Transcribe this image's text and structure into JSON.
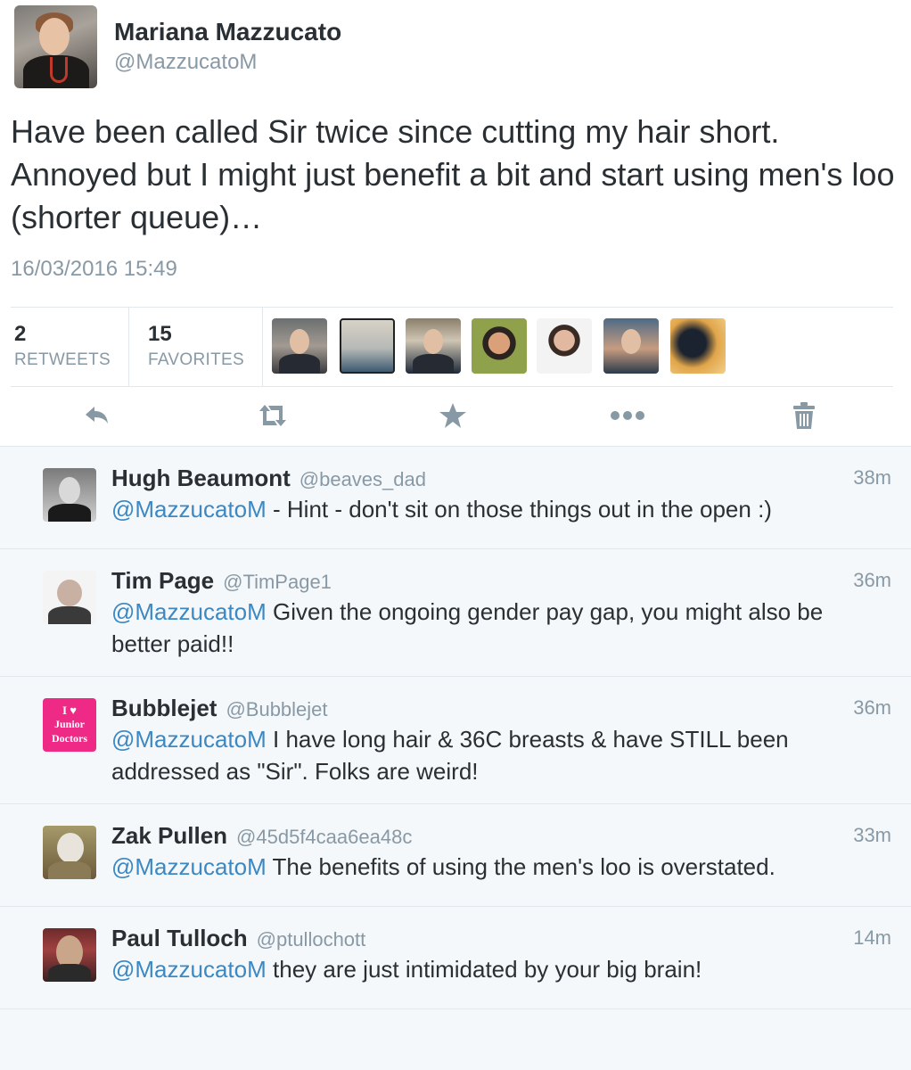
{
  "tweet": {
    "author_name": "Mariana Mazzucato",
    "author_handle": "@MazzucatoM",
    "text": "Have been called Sir twice since cutting my hair short. Annoyed but I might just benefit a bit and start using men's loo (shorter queue)…",
    "timestamp": "16/03/2016 15:49",
    "retweets_count": "2",
    "retweets_label": "RETWEETS",
    "favorites_count": "15",
    "favorites_label": "FAVORITES"
  },
  "actions": [
    "reply-icon",
    "retweet-icon",
    "favorite-icon",
    "more-icon",
    "delete-icon"
  ],
  "colors": {
    "link": "#3b88c3",
    "secondary_text": "#8899a6",
    "primary_text": "#292f33",
    "icon": "#8899a6",
    "background": "#f5f8fa"
  },
  "replies": [
    {
      "name": "Hugh Beaumont",
      "handle": "@beaves_dad",
      "time": "38m",
      "mention": "@MazzucatoM",
      "text": " - Hint - don't sit on those things out in the open :)"
    },
    {
      "name": "Tim Page",
      "handle": "@TimPage1",
      "time": "36m",
      "mention": "@MazzucatoM",
      "text": " Given the ongoing gender pay gap, you might also be better paid!!"
    },
    {
      "name": "Bubblejet",
      "handle": "@Bubblejet",
      "time": "36m",
      "mention": "@MazzucatoM",
      "text": " I have long hair & 36C breasts & have STILL been addressed as \"Sir\". Folks are weird!",
      "avatar_text": [
        "I ♥",
        "Junior",
        "Doctors"
      ]
    },
    {
      "name": "Zak Pullen",
      "handle": "@45d5f4caa6ea48c",
      "time": "33m",
      "mention": "@MazzucatoM",
      "text": " The benefits of using the men's loo is overstated."
    },
    {
      "name": "Paul Tulloch",
      "handle": "@ptullochott",
      "time": "14m",
      "mention": "@MazzucatoM",
      "text": " they are just intimidated by your big brain!"
    }
  ]
}
